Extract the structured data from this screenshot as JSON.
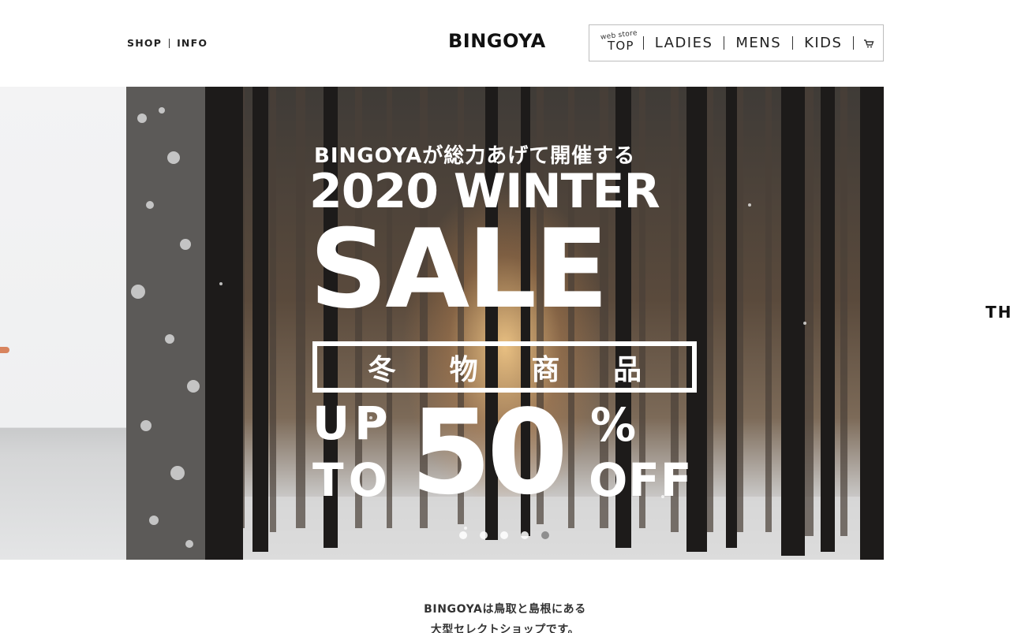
{
  "header": {
    "links": [
      "SHOP",
      "INFO"
    ],
    "logo": "BINGOYA",
    "nav": {
      "top_small": "web store",
      "top_big": "TOP",
      "items": [
        "LADIES",
        "MENS",
        "KIDS"
      ]
    }
  },
  "hero": {
    "headline": "BINGOYAが総力あげて開催する",
    "title_line1": "2020 WINTER",
    "title_line2": "SALE",
    "category": [
      "冬",
      "物",
      "商",
      "品"
    ],
    "up": "UP",
    "to": "TO",
    "percent_number": "50",
    "percent_sign": "%",
    "off": "OFF",
    "dots_count": 5,
    "active_dot": 0
  },
  "next_slide_text": "TH",
  "intro": {
    "line1": "BINGOYAは鳥取と島根にある",
    "line2": "大型セレクトショップです。"
  },
  "colors": {
    "text": "#222222",
    "border": "#bdbdbd",
    "hero_overlay_text": "#ffffff"
  }
}
